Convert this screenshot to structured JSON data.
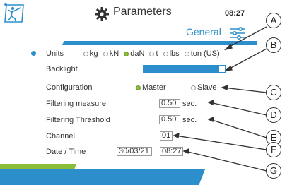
{
  "header": {
    "title": "Parameters",
    "time": "08:27",
    "logo_icon": "walking-person-logo-icon",
    "title_icon": "gear-icon"
  },
  "section": {
    "label": "General",
    "icon": "sliders-icon"
  },
  "rows": {
    "units": {
      "label": "Units",
      "options": [
        "kg",
        "kN",
        "daN",
        "t",
        "lbs",
        "ton (US)"
      ],
      "selected": "daN"
    },
    "backlight": {
      "label": "Backlight",
      "level": 0.93
    },
    "configuration": {
      "label": "Configuration",
      "options": [
        "Master",
        "Slave"
      ],
      "selected": "Master"
    },
    "filtering_measure": {
      "label": "Filtering measure",
      "value": "0.50",
      "unit": "sec."
    },
    "filtering_threshold": {
      "label": "Filtering Threshold",
      "value": "0.50",
      "unit": "sec."
    },
    "channel": {
      "label": "Channel",
      "value": "01"
    },
    "datetime": {
      "label": "Date / Time",
      "date": "30/03/21",
      "time": "08:27"
    }
  },
  "callouts": [
    "A",
    "B",
    "C",
    "D",
    "E",
    "F",
    "G"
  ],
  "colors": {
    "accent_blue": "#2c8fcb",
    "accent_green": "#8bbd3a"
  }
}
